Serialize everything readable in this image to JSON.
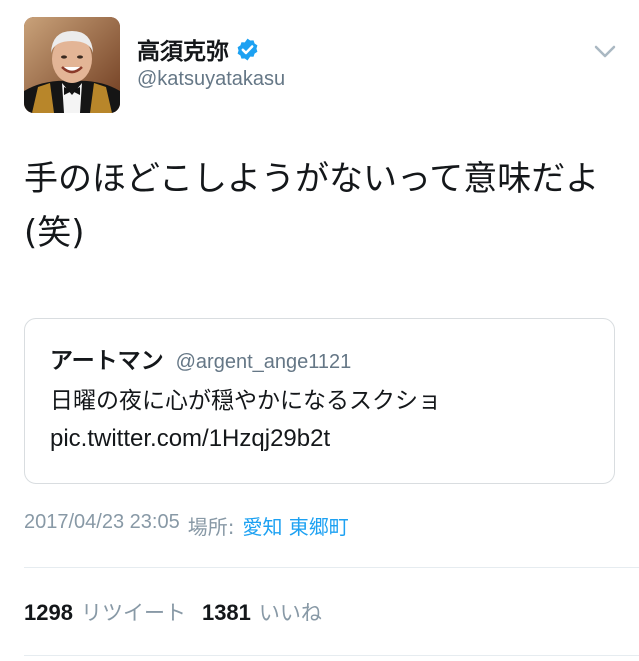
{
  "author": {
    "display_name": "高須克弥",
    "handle": "@katsuyatakasu",
    "avatar_icon": "profile-photo",
    "verified_icon": "verified-badge-icon"
  },
  "tweet": {
    "text": "手のほどこしようがないって意味だよ(笑)"
  },
  "quoted_tweet": {
    "display_name": "アートマン",
    "handle": "@argent_ange1121",
    "text": "日曜の夜に心が穏やかになるスクショ",
    "link": "pic.twitter.com/1Hzqj29b2t"
  },
  "meta": {
    "timestamp": "2017/04/23 23:05",
    "location_label": "場所:",
    "location": "愛知 東郷町"
  },
  "stats": {
    "retweets_count": "1298",
    "retweets_label": "リツイート",
    "likes_count": "1381",
    "likes_label": "いいね"
  },
  "colors": {
    "link": "#1da1f2",
    "muted": "#8899a6",
    "text": "#14171a",
    "verified": "#1da1f2"
  }
}
